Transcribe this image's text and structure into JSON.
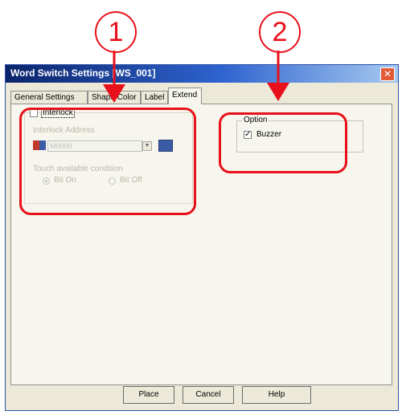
{
  "callouts": {
    "one": "1",
    "two": "2"
  },
  "window": {
    "title": "Word Switch Settings [WS_001]"
  },
  "tabs": [
    "General Settings",
    "Shape/Color",
    "Label",
    "Extend"
  ],
  "interlock": {
    "checkbox_label": "Interlock",
    "address_label": "Interlock Address",
    "address_value": "M0000",
    "touch_label": "Touch available condition",
    "on_label": "Bit On",
    "off_label": "Bit Off"
  },
  "option": {
    "group_title": "Option",
    "buzzer_label": "Buzzer",
    "buzzer_checked": true
  },
  "buttons": {
    "place": "Place",
    "cancel": "Cancel",
    "help": "Help"
  },
  "colors": {
    "annotation": "#e8101a",
    "titlebar": "#0a246a",
    "dialog_bg": "#ece9d8"
  }
}
